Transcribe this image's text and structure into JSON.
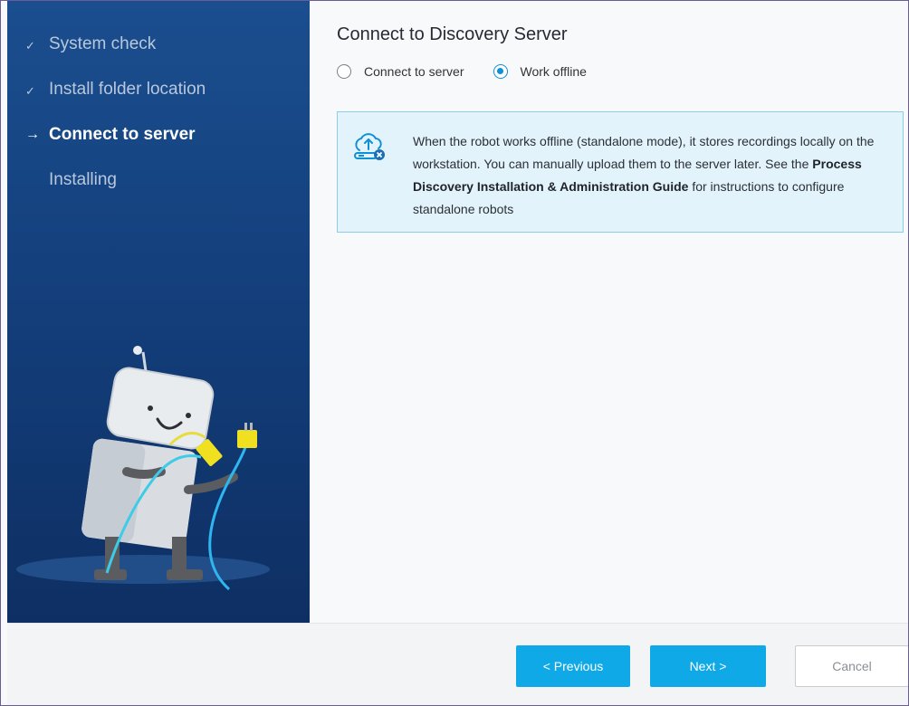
{
  "sidebar": {
    "steps": [
      {
        "label": "System check",
        "state": "done",
        "mark": "✓"
      },
      {
        "label": "Install folder location",
        "state": "done",
        "mark": "✓"
      },
      {
        "label": "Connect to server",
        "state": "active",
        "mark": "→"
      },
      {
        "label": "Installing",
        "state": "pending",
        "mark": ""
      }
    ]
  },
  "main": {
    "title": "Connect to Discovery Server",
    "options": [
      {
        "label": "Connect to server",
        "checked": false
      },
      {
        "label": "Work offline",
        "checked": true
      }
    ],
    "info": {
      "icon": "cloud-offline-icon",
      "text_part1": "When the robot works offline (standalone mode), it stores recordings locally on the workstation. You can manually upload them to the server later. See the ",
      "text_bold": "Process Discovery Installation & Administration Guide",
      "text_part2": " for instructions to configure standalone robots"
    }
  },
  "footer": {
    "previous_label": "< Previous",
    "next_label": "Next >",
    "cancel_label": "Cancel"
  },
  "colors": {
    "accent": "#0fa9e8",
    "sidebar": "#133e7a",
    "info_bg": "#e3f3fb"
  }
}
